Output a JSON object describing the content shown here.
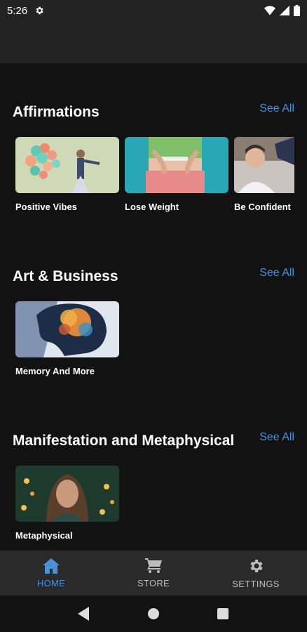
{
  "status": {
    "time": "5:26"
  },
  "sections": [
    {
      "title": "Affirmations",
      "see_all": "See All",
      "items": [
        {
          "label": "Positive Vibes"
        },
        {
          "label": "Lose Weight"
        },
        {
          "label": "Be Confident"
        }
      ]
    },
    {
      "title": "Art & Business",
      "see_all": "See All",
      "items": [
        {
          "label": "Memory And More"
        }
      ]
    },
    {
      "title": "Manifestation and Metaphysical",
      "see_all": "See All",
      "items": [
        {
          "label": "Metaphysical"
        }
      ]
    }
  ],
  "nav": {
    "home": "HOME",
    "store": "STORE",
    "settings": "SETTINGS"
  },
  "colors": {
    "accent": "#4a90d9",
    "background": "#121212",
    "bar": "#232323"
  }
}
